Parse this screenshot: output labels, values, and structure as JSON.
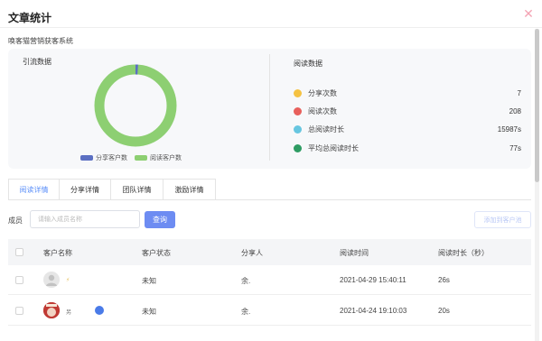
{
  "dialog": {
    "title": "文章统计",
    "close_glyph": "✕"
  },
  "article": {
    "name": "唤客猫营销获客系统"
  },
  "traffic": {
    "title": "引流数据",
    "legend": [
      {
        "label": "分享客户数",
        "color": "#5b6fc2",
        "value": 1
      },
      {
        "label": "阅读客户数",
        "color": "#8dcf72",
        "value": 99
      }
    ]
  },
  "reading": {
    "title": "阅读数据",
    "metrics": [
      {
        "label": "分享次数",
        "value": "7",
        "color": "#f5c242"
      },
      {
        "label": "阅读次数",
        "value": "208",
        "color": "#e8605c"
      },
      {
        "label": "总阅读时长",
        "value": "15987s",
        "color": "#67c6e0"
      },
      {
        "label": "平均总阅读时长",
        "value": "77s",
        "color": "#2e9c63"
      }
    ]
  },
  "tabs": [
    "阅读详情",
    "分享详情",
    "团队详情",
    "激励详情"
  ],
  "filter": {
    "label": "成员",
    "placeholder": "请输入成员名称",
    "query_label": "查询",
    "add_label": "添加到客户池"
  },
  "table": {
    "columns": [
      "客户名称",
      "客户状态",
      "分享人",
      "阅读时间",
      "阅读时长（秒）"
    ],
    "rows": [
      {
        "name": "⚡",
        "status": "未知",
        "sharer": "余.",
        "time": "2021-04-29 15:40:11",
        "duration": "26s"
      },
      {
        "name": "另",
        "status": "未知",
        "sharer": "余.",
        "time": "2021-04-24 19:10:03",
        "duration": "20s"
      }
    ]
  }
}
